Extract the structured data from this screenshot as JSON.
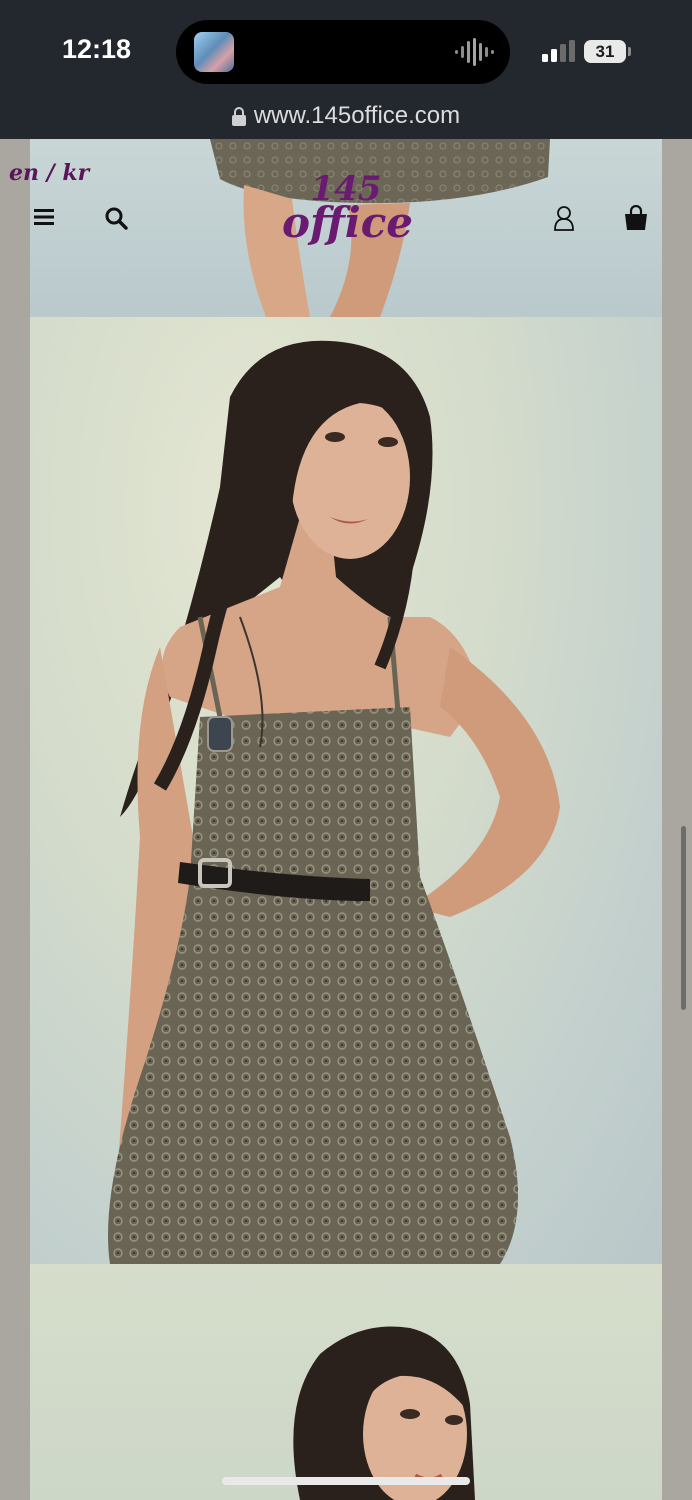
{
  "status_bar": {
    "time": "12:18",
    "battery": "31"
  },
  "browser": {
    "url": "www.145office.com"
  },
  "site": {
    "language_switch": "en / kr",
    "logo_number": "145",
    "logo_word": "office",
    "icons": [
      "menu-icon",
      "search-icon",
      "account-icon",
      "cart-icon"
    ],
    "brand_color": "#6a1a70"
  },
  "gallery": {
    "images": [
      "product-photo-top",
      "product-photo-main",
      "product-photo-bottom"
    ]
  }
}
